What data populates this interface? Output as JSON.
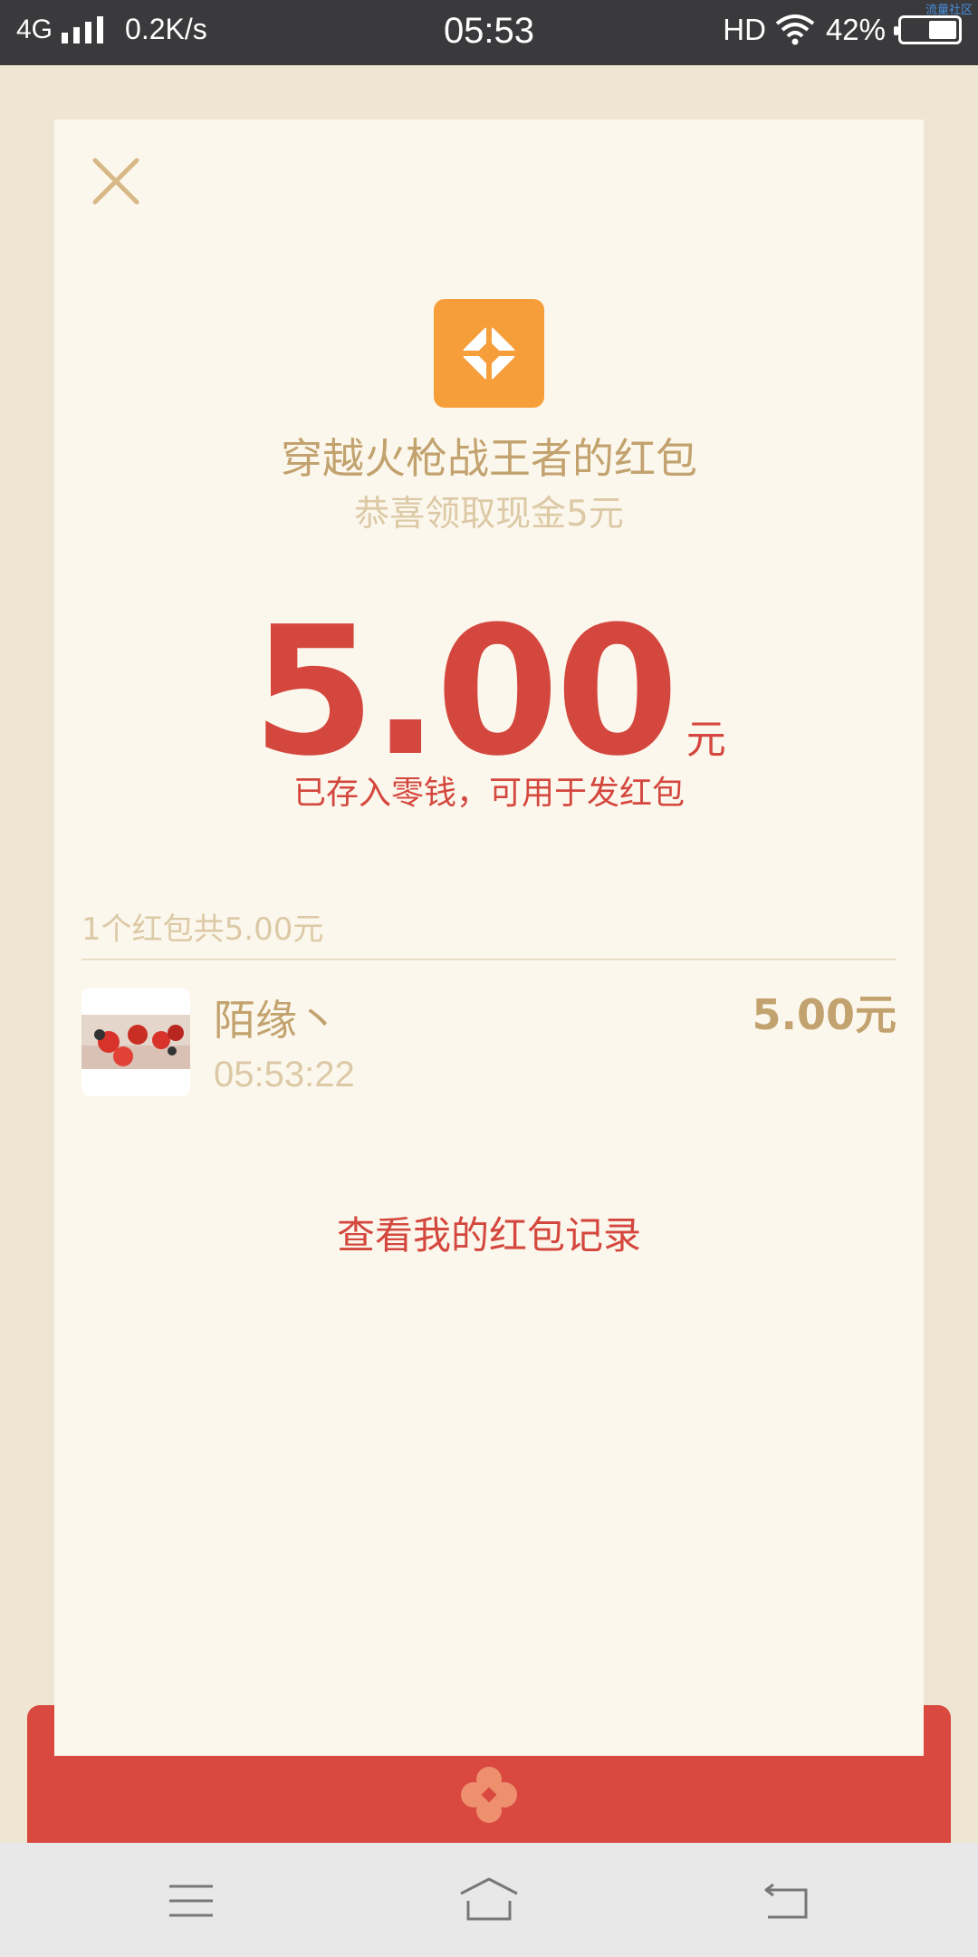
{
  "status_bar": {
    "network": "4G",
    "speed": "0.2K/s",
    "time": "05:53",
    "hd": "HD",
    "battery": "42%",
    "watermark": "流量社区"
  },
  "card": {
    "title": "穿越火枪战王者的红包",
    "subtitle": "恭喜领取现金5元",
    "amount": "5.00",
    "amount_unit": "元",
    "stored_text": "已存入零钱，可用于发红包",
    "summary": "1个红包共5.00元",
    "records": [
      {
        "name": "陌缘丶",
        "time": "05:53:22",
        "amount": "5.00元"
      }
    ],
    "view_records_link": "查看我的红包记录"
  },
  "icons": {
    "close": "close-icon",
    "app": "app-logo-icon",
    "envelope": "flower-emblem-icon",
    "nav": [
      "menu-icon",
      "home-icon",
      "back-icon"
    ]
  },
  "colors": {
    "accent_red": "#D4473E",
    "gold": "#C2A26E",
    "card_bg": "#FCF7EC",
    "app_orange": "#F69F3A"
  }
}
